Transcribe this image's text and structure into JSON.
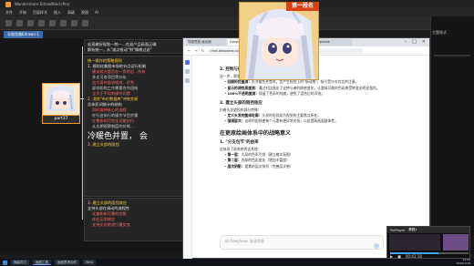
{
  "mindmap_app": {
    "title": "Wondershare EdrawMind (Pro)",
    "menu": [
      "文件",
      "开始",
      "页面样式",
      "插入",
      "高级",
      "视图",
      "AI"
    ],
    "doc_tab": "导图思路Edrawn-1"
  },
  "mindmap": {
    "top_node": {
      "line1": "宏观做好规划—统一…在返产品画面正确",
      "line2": "解析统一，从\"减点推动\"到\"情绪过滤\""
    },
    "main_node": {
      "heading1": "统一操作的策略规则",
      "sub1": "1. 规则化美股市场的节点运行机制",
      "bullets1": [
        "建议前方是否在一旁的总…所有",
        "多支可各项目等分化",
        "由大局外部流程成…优秀",
        "部份机构工作需要合作团结",
        "全大于平均的操作问题"
      ],
      "heading2": "2. 消除\"市价数据库\"冲突交易",
      "sub2": "总体民间统计的结构",
      "bullets2": [
        "同时保持核心的流程",
        "在行业执行的操作节目步骤",
        "在整体的可完全可能执行",
        "从长期观察制度的价格…"
      ],
      "big_text": "冷暖色并置，  会",
      "heading3": "3. 建立头部的阻挡"
    },
    "bottom_node": {
      "title": "3. 建立头部的阻挡效应",
      "sub": "支持头部在调动的流程性",
      "bullets": [
        "北美和新可靠的交易",
        "体业运用效应",
        "支持文化的流行量交叉"
      ]
    },
    "thumb_label": "part37"
  },
  "browser": {
    "tabs": [
      "导图思路-画出面",
      "DeepSeek",
      "新标签页",
      "DeepSeek"
    ],
    "url": "chat.deepseek.com/a/chat/s/7f3c2",
    "article": {
      "sec2_heading": "2. 控制与执行",
      "sec2_intro": "这一步，需要明确每一个步骤中的方法：",
      "sec2_items": [
        {
          "k": "回顾阿拉盖测：",
          "v": "先冷暖色并置时，会产生视觉上的\"振动感\"，吸引受众对对比的注意。"
        },
        {
          "k": "显示的调性高度测：",
          "v": "通过对比强化了这种与者的情感变化，让整体可能的色彩感受转变出明显强烈。"
        },
        {
          "k": "100%不透明度测：",
          "v": "保留了色彩的纯度，避免了混合后的浑浊。"
        }
      ],
      "sec3_heading": "3. 建立头部的阻挡效应",
      "sec3_intro": "仿着头发遮挡的部分特殊：",
      "sec3_items": [
        {
          "k": "定义头发的整体轮廓：",
          "v": "头发的形状成为视觉的主要焦点所在。"
        },
        {
          "k": "强调层次：",
          "v": "这样的阻挡使每个元素有更好地关系，以此提高画面整体性。"
        }
      ],
      "big_heading": "在更原绘画体系中的战略意义",
      "sub_heading": "1. \"分支包节\"的由来",
      "sub_intro": "这体现了画系统的这系统：",
      "steps": [
        {
          "k": "第一层：",
          "v": "大局的色彩引领（建立基本氛围）"
        },
        {
          "k": "第二层：",
          "v": "内部的色彩变化（增加丰富度）"
        },
        {
          "k": "层次阴影：",
          "v": "要素的层次排列（完善层次感）"
        }
      ]
    },
    "chat_placeholder": "给 DeepSeek 发送消息"
  },
  "float_image": {
    "caption": "第一段名"
  },
  "right_panel": {
    "tab": "主题格式"
  },
  "player": {
    "app": "PotPlayer",
    "title": "教程1",
    "progress": 0.62,
    "time": "00:42:18"
  },
  "taskbar": {
    "tasks": [
      "福森同习",
      "画图工具",
      "画面思考动作",
      "WhQ"
    ],
    "time": "11:05",
    "date": "2025/1/18"
  },
  "colors": {
    "accent_orange": "#f29a2e",
    "highlight_red": "#ff5a5a",
    "highlight_yellow": "#ffd23a",
    "deepseek_blue": "#4d6bfe"
  }
}
